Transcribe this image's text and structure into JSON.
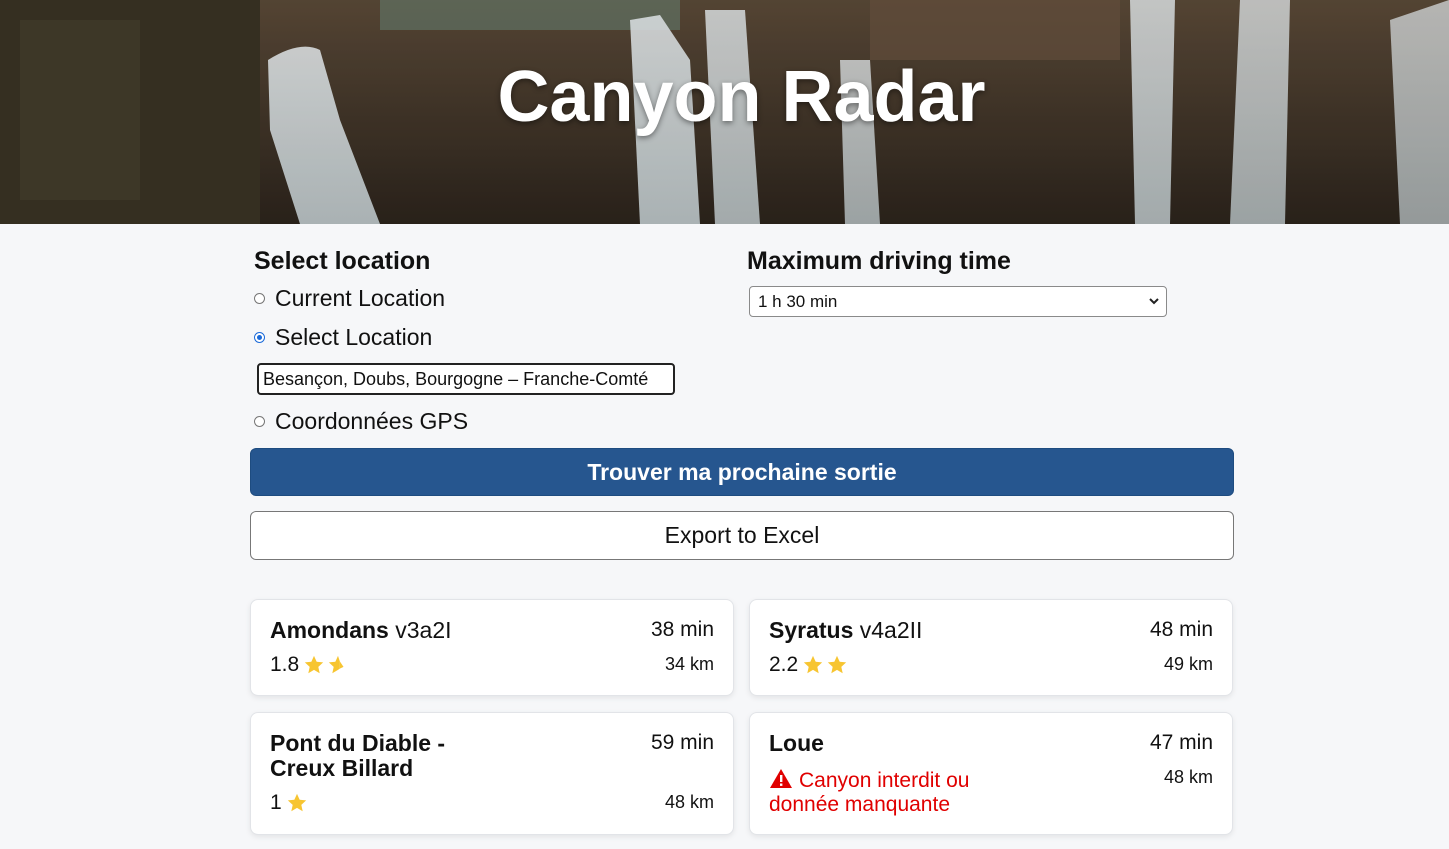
{
  "header": {
    "title": "Canyon Radar"
  },
  "location": {
    "title": "Select location",
    "options": [
      {
        "label": "Current Location",
        "checked": false
      },
      {
        "label": "Select Location",
        "checked": true
      },
      {
        "label": "Coordonnées GPS",
        "checked": false
      }
    ],
    "input_value": "Besançon, Doubs, Bourgogne – Franche-Comté"
  },
  "driving": {
    "title": "Maximum driving time",
    "selected": "1 h 30 min"
  },
  "actions": {
    "find_label": "Trouver ma prochaine sortie",
    "export_label": "Export to Excel"
  },
  "results": [
    {
      "name": "Amondans",
      "code": "v3a2I",
      "time": "38 min",
      "distance": "34 km",
      "rating": "1.8",
      "stars": 1.8
    },
    {
      "name": "Syratus",
      "code": "v4a2II",
      "time": "48 min",
      "distance": "49 km",
      "rating": "2.2",
      "stars": 2
    },
    {
      "name": "Pont du Diable - Creux Billard",
      "code": "",
      "time": "59 min",
      "distance": "48 km",
      "rating": "1",
      "stars": 1
    },
    {
      "name": "Loue",
      "code": "",
      "time": "47 min",
      "distance": "48 km",
      "warning": "Canyon interdit ou donnée manquante"
    }
  ],
  "colors": {
    "primary": "#26568f",
    "warning": "#e00000",
    "star": "#f7c531"
  }
}
